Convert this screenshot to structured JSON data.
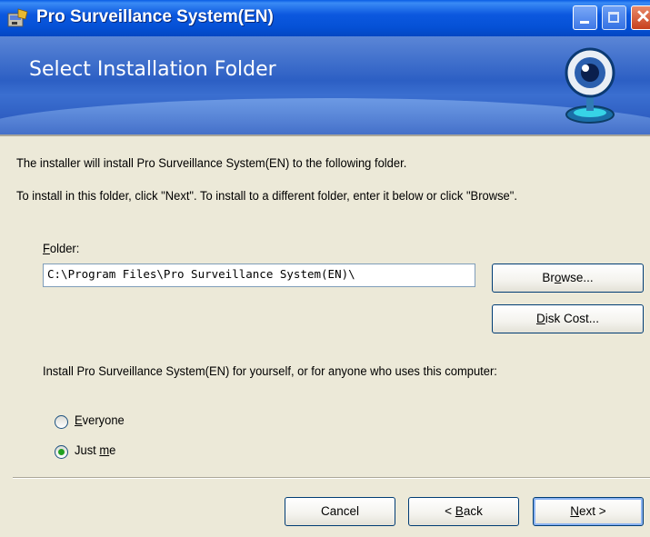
{
  "window": {
    "title": "Pro Surveillance System(EN)"
  },
  "banner": {
    "title": "Select Installation Folder"
  },
  "content": {
    "intro_line": "The installer will install Pro Surveillance System(EN) to the following folder.",
    "instruction_line": "To install in this folder, click \"Next\". To install to a different folder, enter it below or click \"Browse\".",
    "folder_label_accel": "F",
    "folder_label_rest": "older:",
    "folder_value": "C:\\Program Files\\Pro Surveillance System(EN)\\",
    "browse_pre": "Br",
    "browse_accel": "o",
    "browse_post": "wse...",
    "disk_cost_accel": "D",
    "disk_cost_rest": "isk Cost...",
    "scope_question": "Install Pro Surveillance System(EN) for yourself, or for anyone who uses this computer:",
    "everyone_accel": "E",
    "everyone_rest": "veryone",
    "justme_pre": "Just ",
    "justme_accel": "m",
    "justme_post": "e",
    "selected_option": "Just me"
  },
  "footer": {
    "cancel": "Cancel",
    "back_pre": "< ",
    "back_accel": "B",
    "back_post": "ack",
    "next_accel": "N",
    "next_post": "ext >"
  },
  "colors": {
    "titlebar": "#0551d6",
    "banner": "#2c5fc4",
    "dialog_bg": "#ece9d8",
    "radio_selected": "#21a121"
  }
}
